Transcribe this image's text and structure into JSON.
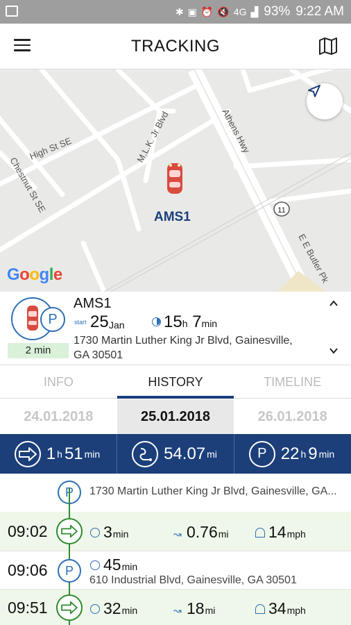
{
  "status_bar": {
    "battery": "93%",
    "time": "9:22 AM",
    "network": "4G"
  },
  "header": {
    "title": "TRACKING"
  },
  "map": {
    "streets": [
      "High St SE",
      "M.L.K. Jr Blvd",
      "Athens Hwy",
      "Chestnut St SE",
      "E E Butler Pk"
    ],
    "route_shield": "11",
    "vehicle_label": "AMS1",
    "provider": "Google"
  },
  "vehicle": {
    "name": "AMS1",
    "status_duration": "2 min",
    "start_label": "start",
    "start_day": "25",
    "start_month": "Jan",
    "duration_hours": "15",
    "duration_hours_unit": "h",
    "duration_minutes": "7",
    "duration_minutes_unit": "min",
    "address_line1": "1730 Martin Luther King Jr Blvd, Gainesville,",
    "address_line2": "GA 30501"
  },
  "tabs": [
    {
      "label": "INFO"
    },
    {
      "label": "HISTORY"
    },
    {
      "label": "TIMELINE"
    }
  ],
  "dates": [
    {
      "label": "24.01.2018"
    },
    {
      "label": "25.01.2018"
    },
    {
      "label": "26.01.2018"
    }
  ],
  "summary": {
    "drive_hours": "1",
    "drive_hours_unit": "h",
    "drive_minutes": "51",
    "drive_minutes_unit": "min",
    "distance": "54.07",
    "distance_unit": "mi",
    "park_hours": "22",
    "park_hours_unit": "h",
    "park_minutes": "9",
    "park_minutes_unit": "min"
  },
  "timeline": {
    "first_stop_address": "1730 Martin Luther King Jr Blvd, Gainesville, GA...",
    "trips": [
      {
        "time": "09:02",
        "duration": "3",
        "duration_unit": "min",
        "distance": "0.76",
        "distance_unit": "mi",
        "speed": "14",
        "speed_unit": "mph"
      },
      {
        "time": "09:51",
        "duration": "32",
        "duration_unit": "min",
        "distance": "18",
        "distance_unit": "mi",
        "speed": "34",
        "speed_unit": "mph"
      }
    ],
    "stop": {
      "time": "09:06",
      "duration": "45",
      "duration_unit": "min",
      "address": "610 Industrial Blvd, Gainesville, GA 30501"
    }
  },
  "colors": {
    "primary": "#1c3f7a",
    "accent": "#2d6fb4",
    "drive_green": "#2e8b2e",
    "trip_row_bg": "#eef7e9"
  }
}
